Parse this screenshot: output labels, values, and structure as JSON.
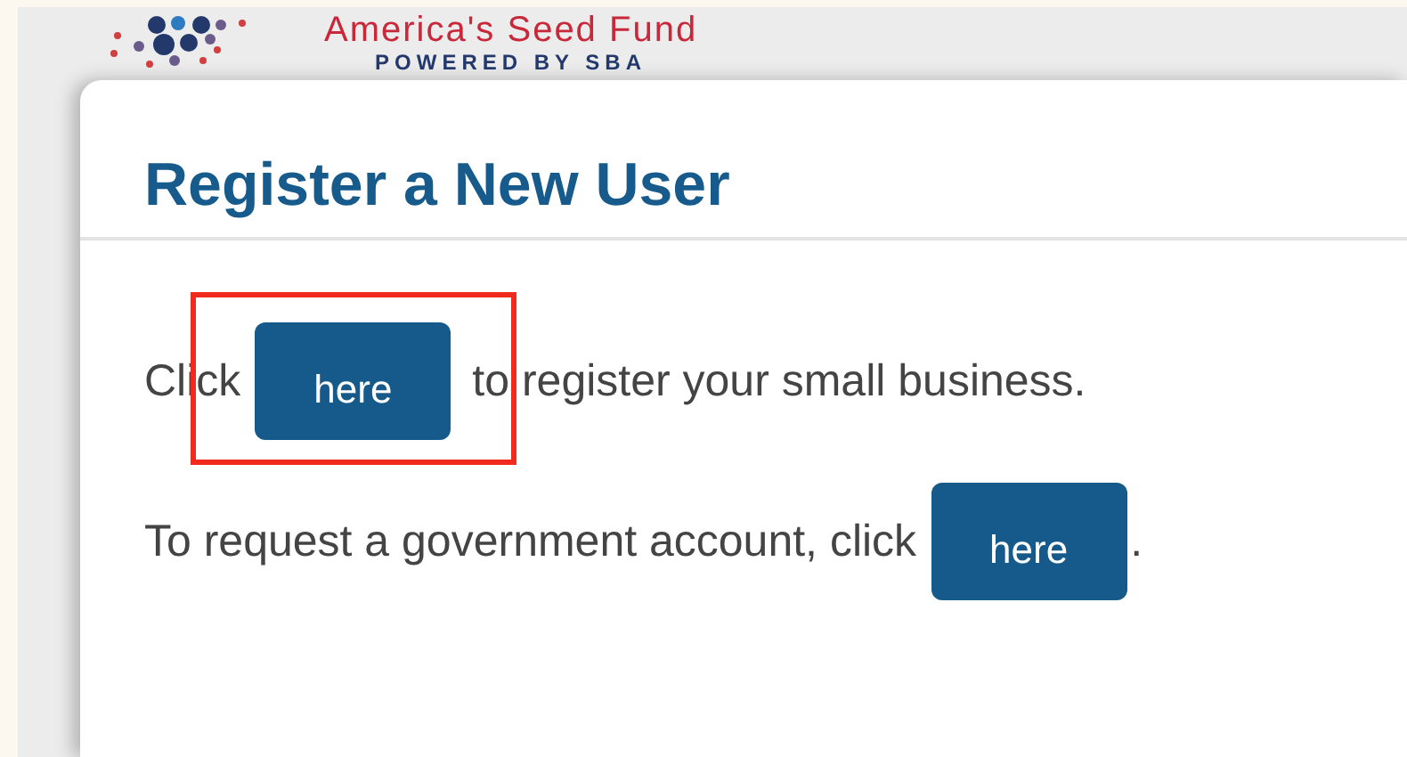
{
  "header": {
    "brand": "America's Seed Fund",
    "tagline": "POWERED BY SBA"
  },
  "dialog": {
    "title": "Register a New User",
    "lines": [
      {
        "before": "Click",
        "button": "here",
        "after": "to register your small business.",
        "highlighted": true
      },
      {
        "before": "To request a government account, click",
        "button": "here",
        "after": ".",
        "highlighted": false
      }
    ]
  }
}
